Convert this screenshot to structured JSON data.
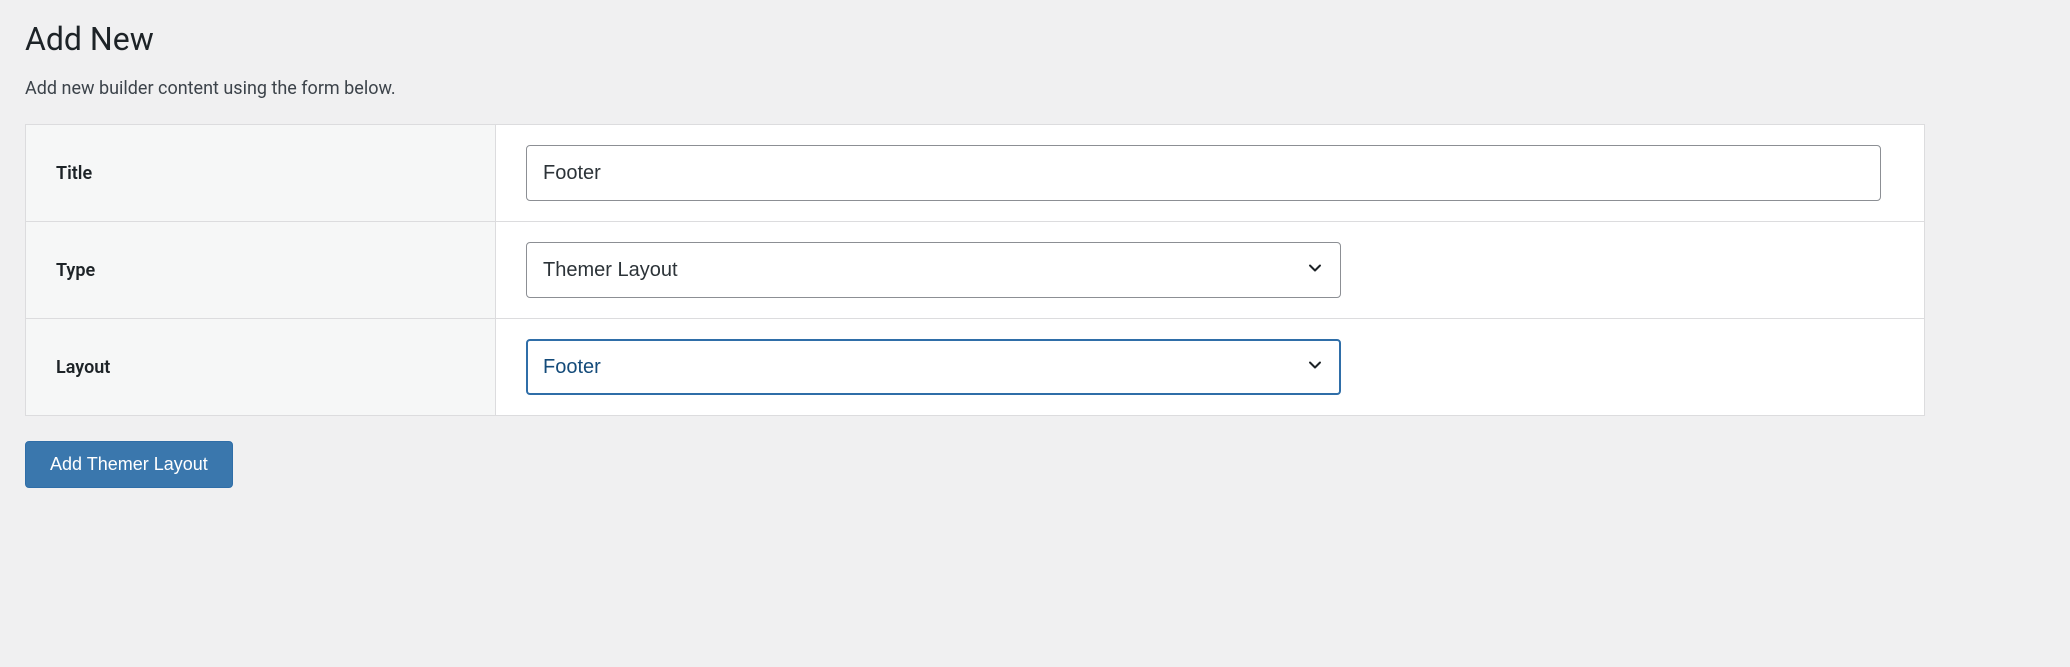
{
  "header": {
    "title": "Add New",
    "description": "Add new builder content using the form below."
  },
  "form": {
    "title": {
      "label": "Title",
      "value": "Footer"
    },
    "type": {
      "label": "Type",
      "value": "Themer Layout"
    },
    "layout": {
      "label": "Layout",
      "value": "Footer"
    }
  },
  "submit": {
    "label": "Add Themer Layout"
  }
}
